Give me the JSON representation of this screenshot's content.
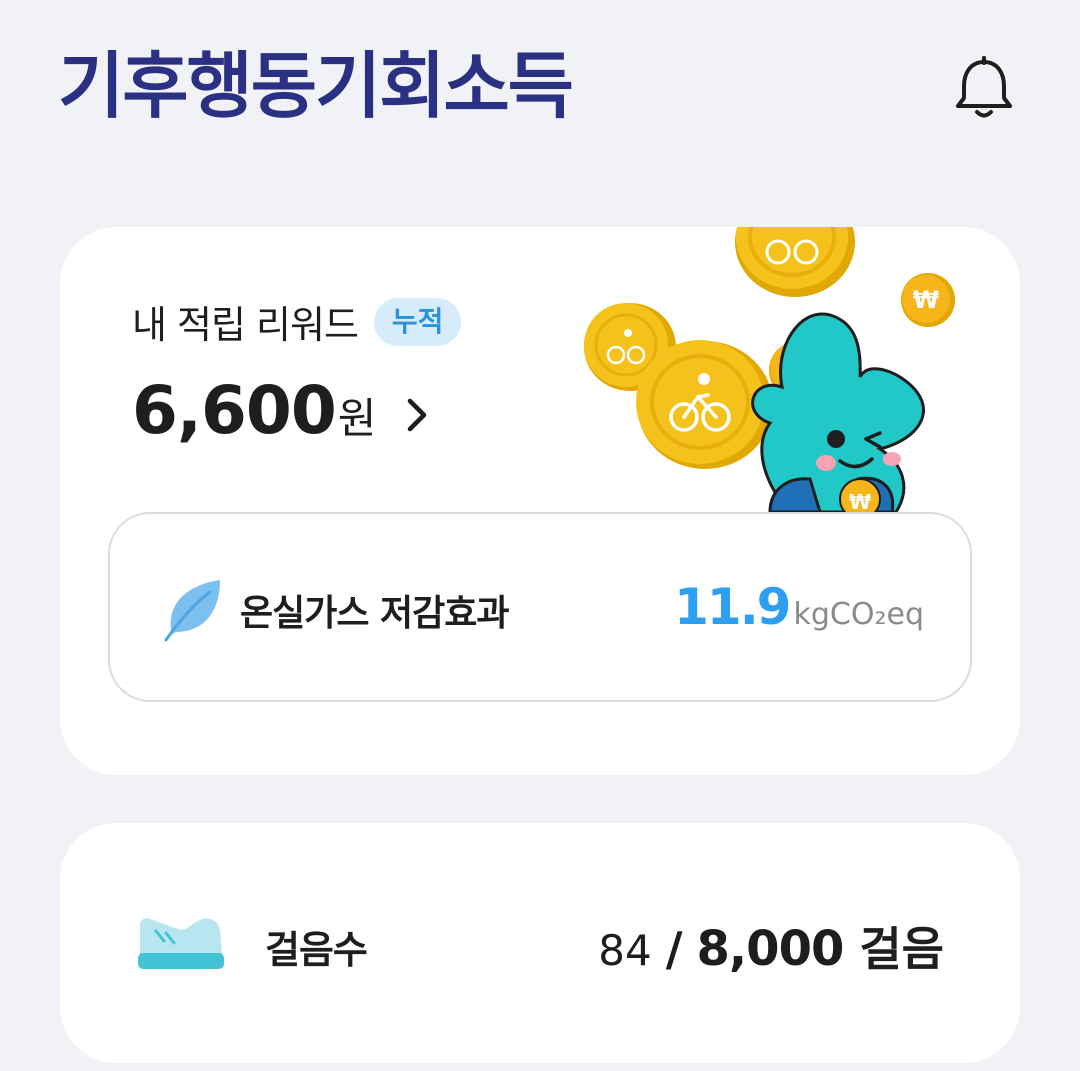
{
  "header": {
    "logo_text": "기후행동기회소득",
    "notification_icon": "bell-icon"
  },
  "reward": {
    "title": "내 적립 리워드",
    "badge": "누적",
    "amount": "6,600",
    "unit": "원",
    "detail_icon": "chevron-right-icon"
  },
  "ghg": {
    "icon": "leaf-icon",
    "label": "온실가스 저감효과",
    "value": "11.9",
    "unit": "kgCO₂eq"
  },
  "steps": {
    "icon": "shoe-icon",
    "label": "걸음수",
    "current": "84",
    "separator": "/",
    "goal": "8,000",
    "unit": "걸음"
  },
  "colors": {
    "brand_navy": "#2b3182",
    "accent_teal": "#1aa7a0",
    "accent_blue": "#2c9ff0",
    "coin_gold": "#f5c21b",
    "mascot_teal": "#22c7c7",
    "background": "#f0f2f5"
  }
}
